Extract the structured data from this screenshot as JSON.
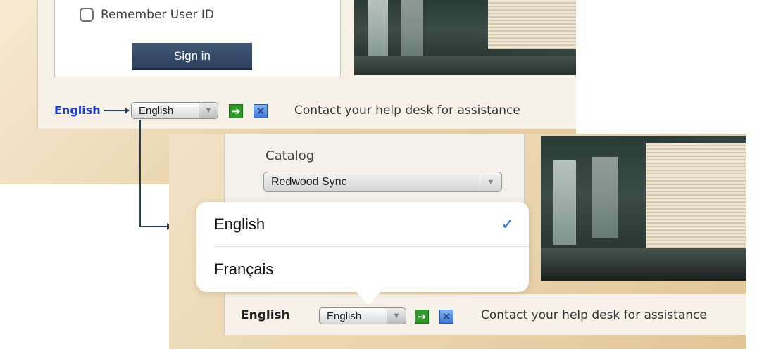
{
  "top": {
    "remember_label": "Remember User ID",
    "signin_label": "Sign in",
    "language_link": "English",
    "language_select_value": "English",
    "contact_text": "Contact your help desk for assistance"
  },
  "bottom": {
    "catalog_label": "Catalog",
    "catalog_value": "Redwood Sync",
    "language_options": [
      {
        "label": "English",
        "selected": true
      },
      {
        "label": "Français",
        "selected": false
      }
    ],
    "check_glyph": "✓",
    "language_label": "English",
    "language_select_value": "English",
    "contact_text": "Contact your help desk for assistance"
  },
  "icons": {
    "go": "➔",
    "close": "✕",
    "dropdown": "▼"
  },
  "colors": {
    "signin_bg": "#2e4260",
    "link": "#1d40c8",
    "check": "#1a73e8",
    "go_icon": "#2f9a2a"
  }
}
